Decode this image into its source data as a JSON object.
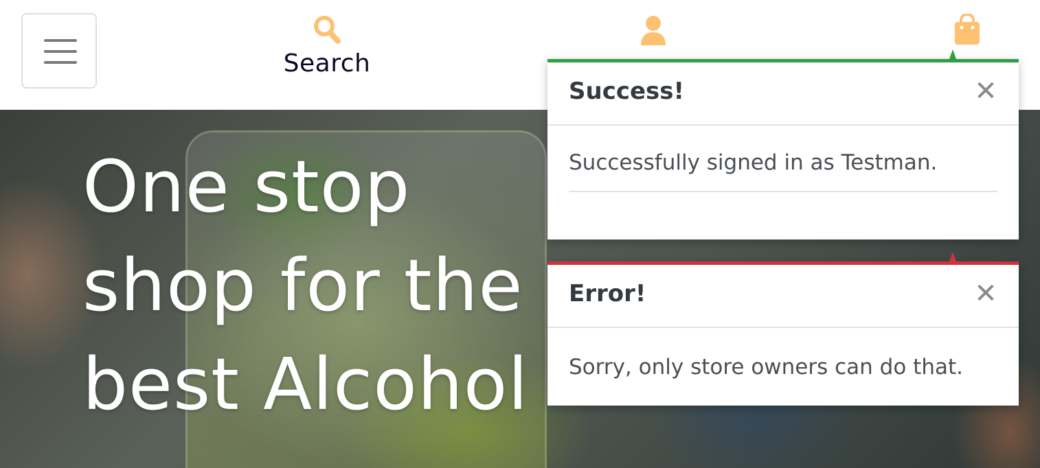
{
  "header": {
    "menu_icon": "hamburger-icon",
    "search": {
      "icon": "search-icon",
      "label": "Search"
    },
    "account": {
      "icon": "user-icon"
    },
    "bag": {
      "icon": "shopping-bag-icon"
    },
    "accent_color": "#fdc271"
  },
  "hero": {
    "title": "One stop shop for the best Alcohol"
  },
  "toasts": [
    {
      "type": "success",
      "title": "Success!",
      "message": "Successfully signed in as Testman.",
      "close_label": "✕",
      "color": "#2f9e44"
    },
    {
      "type": "error",
      "title": "Error!",
      "message": "Sorry, only store owners can do that.",
      "close_label": "✕",
      "color": "#d63040"
    }
  ]
}
